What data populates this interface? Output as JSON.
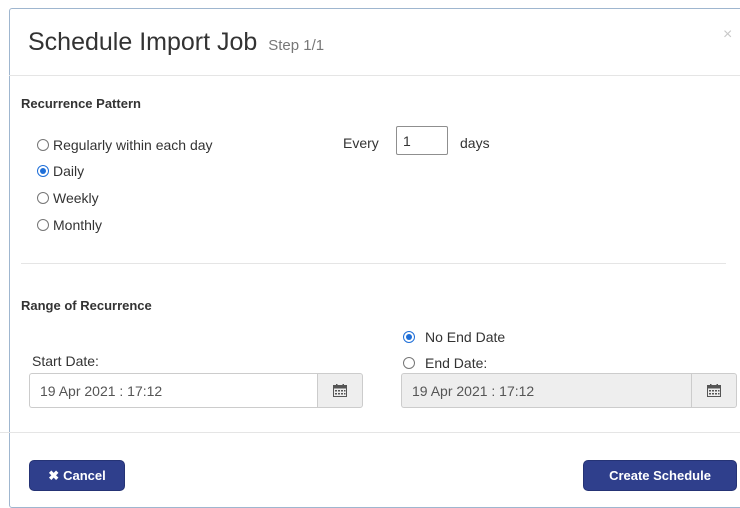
{
  "dialog": {
    "title": "Schedule Import Job",
    "step": "Step 1/1",
    "close_glyph": "×"
  },
  "recurrence": {
    "title": "Recurrence Pattern",
    "options": [
      {
        "label": "Regularly within each day",
        "checked": false
      },
      {
        "label": "Daily",
        "checked": true
      },
      {
        "label": "Weekly",
        "checked": false
      },
      {
        "label": "Monthly",
        "checked": false
      }
    ],
    "every_label": "Every",
    "every_value": "1",
    "days_label": "days"
  },
  "range": {
    "title": "Range of Recurrence",
    "start_label": "Start Date:",
    "start_value": "19 Apr 2021 : 17:12",
    "no_end_label": "No End Date",
    "no_end_checked": true,
    "end_label": "End Date:",
    "end_checked": false,
    "end_value": "19 Apr 2021 : 17:12",
    "end_disabled": true
  },
  "footer": {
    "cancel_label": "Cancel",
    "cancel_icon": "times-icon",
    "create_label": "Create Schedule"
  },
  "colors": {
    "button_bg": "#2f3f8c",
    "radio_accent": "#1f6fd8",
    "dialog_border": "#9fb6cf"
  }
}
